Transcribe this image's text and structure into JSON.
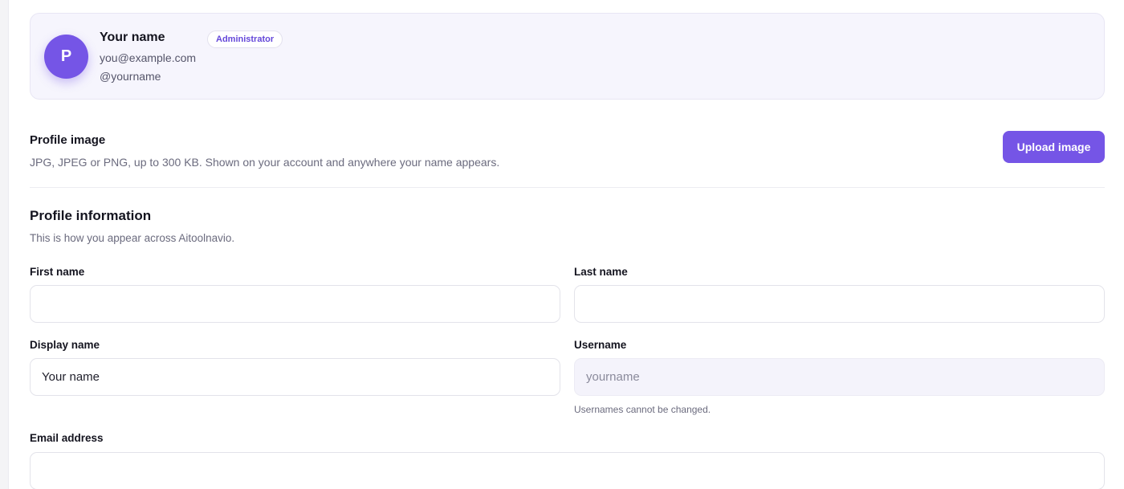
{
  "user": {
    "avatar_initial": "P",
    "name": "Your name",
    "role": "Administrator",
    "email": "you@example.com",
    "handle": "@yourname"
  },
  "profile_image": {
    "title": "Profile image",
    "description": "JPG, JPEG or PNG, up to 300 KB. Shown on your account and anywhere your name appears.",
    "upload_label": "Upload image"
  },
  "profile_info": {
    "title": "Profile information",
    "description": "This is how you appear across Aitoolnavio.",
    "fields": {
      "first_name": {
        "label": "First name",
        "value": ""
      },
      "last_name": {
        "label": "Last name",
        "value": ""
      },
      "display_name": {
        "label": "Display name",
        "value": "Your name"
      },
      "username": {
        "label": "Username",
        "value": "yourname",
        "hint": "Usernames cannot be changed."
      },
      "email": {
        "label": "Email address",
        "value": ""
      }
    }
  },
  "colors": {
    "accent": "#7555e6",
    "card_bg": "#f6f5fd"
  }
}
